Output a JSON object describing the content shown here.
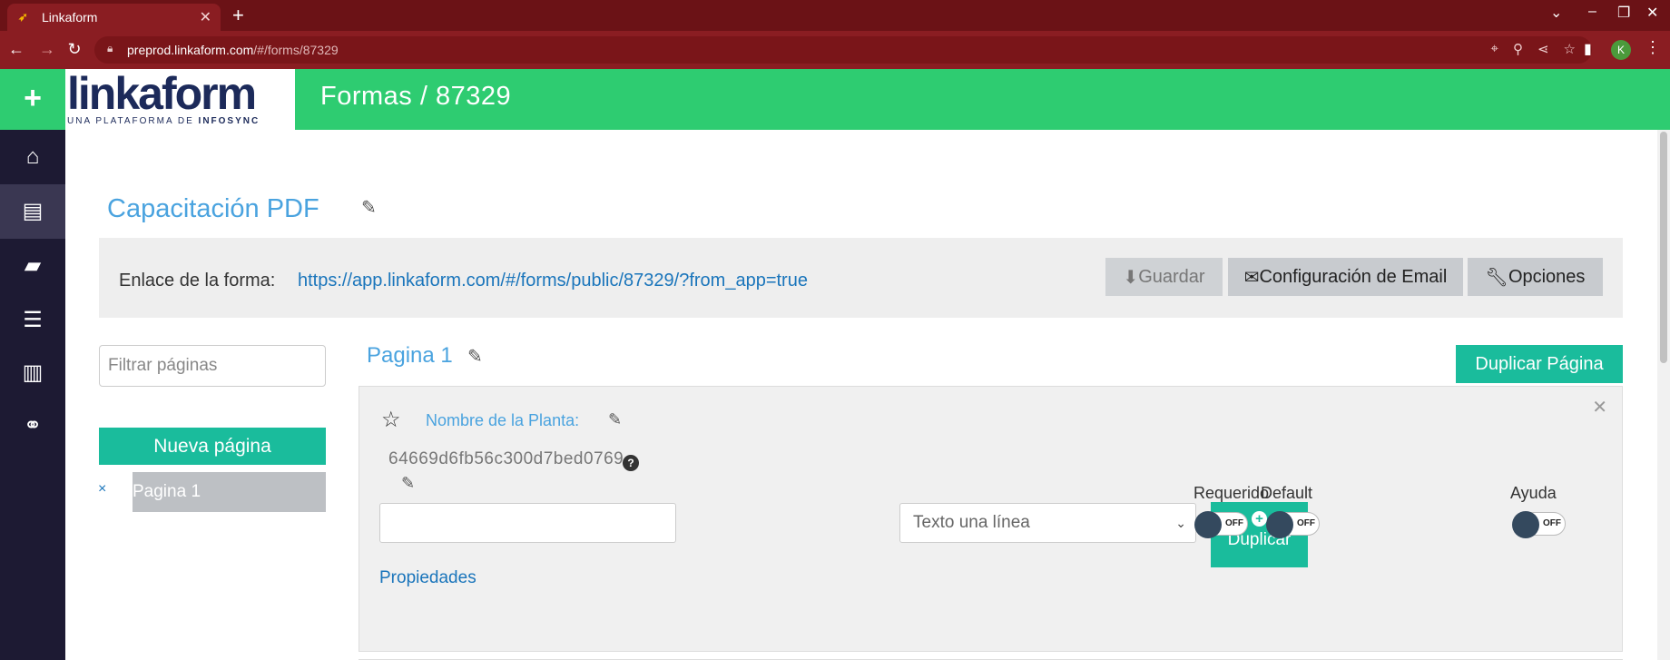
{
  "browser": {
    "tab_title": "Linkaform",
    "url_host": "preprod.linkaform.com",
    "url_path": "/#/forms/87329",
    "profile_initial": "K"
  },
  "app": {
    "logo_word": "linkaform",
    "logo_sub_prefix": "UNA PLATAFORMA DE ",
    "logo_sub_brand": "INFOSYNC",
    "header_title": "Formas / 87329"
  },
  "form": {
    "title": "Capacitación PDF",
    "link_label": "Enlace de la forma:",
    "link_url": "https://app.linkaform.com/#/forms/public/87329/?from_app=true",
    "btn_guardar": "Guardar",
    "btn_email": "Configuración de Email",
    "btn_opciones": "Opciones"
  },
  "pages": {
    "filter_placeholder": "Filtrar páginas",
    "new_page": "Nueva página",
    "remove": "×",
    "items": [
      {
        "label": "Pagina 1"
      }
    ]
  },
  "page": {
    "title": "Pagina 1",
    "duplicate": "Duplicar Página"
  },
  "question": {
    "label": "Nombre de la Planta:",
    "id": "64669d6fb56c300d7bed0769",
    "type": "Texto una línea",
    "duplicate": "Duplicar",
    "required_label": "Requerido",
    "default_label": "Default",
    "help_label": "Ayuda",
    "toggle_off": "OFF",
    "properties": "Propiedades"
  },
  "colors": {
    "header_green": "#2ecc71",
    "accent_teal": "#1abc9c",
    "sidebar_dark": "#1d1a33",
    "browser_red": "#8a1d22",
    "link_blue": "#1a75bb"
  }
}
